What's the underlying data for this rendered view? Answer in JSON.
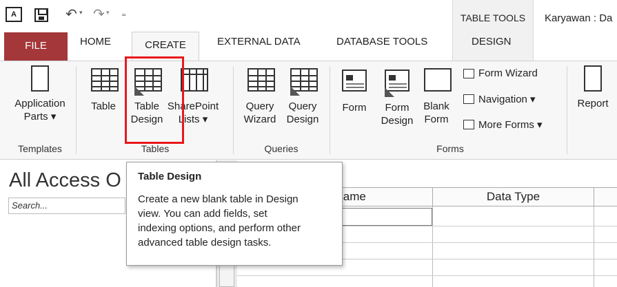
{
  "titlebar": {
    "table_tools": "TABLE TOOLS",
    "doc_title": "Karyawan : Da"
  },
  "tabs": {
    "file": "FILE",
    "home": "HOME",
    "create": "CREATE",
    "external_data": "EXTERNAL DATA",
    "database_tools": "DATABASE TOOLS",
    "design": "DESIGN"
  },
  "ribbon": {
    "templates": {
      "group_label": "Templates",
      "application_parts_1": "Application",
      "application_parts_2": "Parts ▾"
    },
    "tables": {
      "group_label": "Tables",
      "table": "Table",
      "table_design_1": "Table",
      "table_design_2": "Design",
      "sharepoint_1": "SharePoint",
      "sharepoint_2": "Lists ▾"
    },
    "queries": {
      "group_label": "Queries",
      "query_wizard_1": "Query",
      "query_wizard_2": "Wizard",
      "query_design_1": "Query",
      "query_design_2": "Design"
    },
    "forms": {
      "group_label": "Forms",
      "form": "Form",
      "form_design_1": "Form",
      "form_design_2": "Design",
      "blank_form_1": "Blank",
      "blank_form_2": "Form",
      "form_wizard": "Form Wizard",
      "navigation": "Navigation ▾",
      "more_forms": "More Forms ▾"
    },
    "reports": {
      "report": "Report"
    }
  },
  "nav_pane": {
    "title": "All Access O",
    "search_placeholder": "Search..."
  },
  "design_grid": {
    "col_field_name": "lame",
    "col_data_type": "Data Type"
  },
  "tooltip": {
    "title": "Table Design",
    "body_1": "Create a new blank table in Design",
    "body_2": "view. You can add fields, set",
    "body_3": "indexing options, and perform other",
    "body_4": "advanced table design tasks."
  }
}
